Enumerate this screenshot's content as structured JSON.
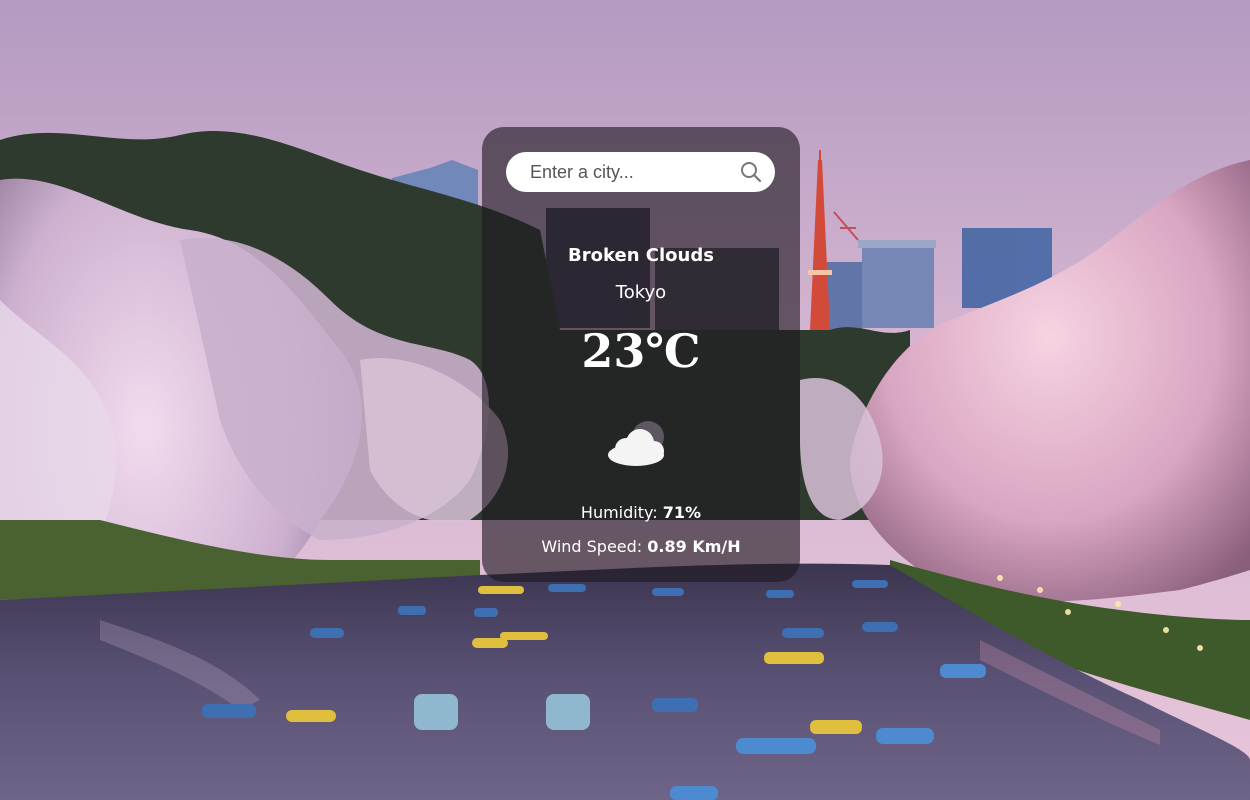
{
  "search": {
    "placeholder": "Enter a city...",
    "value": "",
    "icon": "search-icon"
  },
  "weather": {
    "condition": "Broken Clouds",
    "city": "Tokyo",
    "temperature": "23℃",
    "icon": "cloud-icon",
    "humidity_label": "Humidity:",
    "humidity_value": "71%",
    "wind_label": "Wind Speed:",
    "wind_value": "0.89 Km/H"
  },
  "colors": {
    "sky_top": "#b89bc2",
    "sky_bottom": "#e4c3d9",
    "card_overlay": "#1e1820",
    "text": "#ffffff",
    "blossom": "#e8c9e6",
    "water": "#4b4566"
  }
}
